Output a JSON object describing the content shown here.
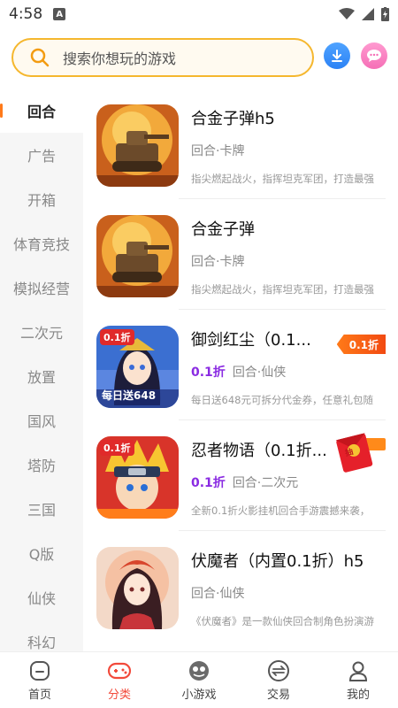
{
  "status": {
    "time": "4:58",
    "a_icon": "A"
  },
  "search": {
    "placeholder": "搜索你想玩的游戏"
  },
  "sidebar": {
    "items": [
      {
        "label": "回合",
        "active": true
      },
      {
        "label": "广告"
      },
      {
        "label": "开箱"
      },
      {
        "label": "体育竞技"
      },
      {
        "label": "模拟经营"
      },
      {
        "label": "二次元"
      },
      {
        "label": "放置"
      },
      {
        "label": "国风"
      },
      {
        "label": "塔防"
      },
      {
        "label": "三国"
      },
      {
        "label": "Q版"
      },
      {
        "label": "仙侠"
      },
      {
        "label": "科幻"
      }
    ]
  },
  "games": [
    {
      "name": "合金子弹h5",
      "tags": "回合·卡牌",
      "desc": "指尖燃起战火，指挥坦克军团，打造最强",
      "icon": "tank-art"
    },
    {
      "name": "合金子弹",
      "tags": "回合·卡牌",
      "desc": "指尖燃起战火，指挥坦克军团，打造最强",
      "icon": "tank-art"
    },
    {
      "name": "御剑红尘（0.1...",
      "discount": "0.1折",
      "tags": "回合·仙侠",
      "badge": "0.1折",
      "desc": "每日送648元可拆分代金券，任意礼包随",
      "thumb_label_top": "0.1折",
      "thumb_label_bottom": "每日送648",
      "icon": "girl-art"
    },
    {
      "name": "忍者物语（0.1折...",
      "discount": "0.1折",
      "tags": "回合·二次元",
      "desc": "全新0.1折火影挂机回合手游震撼来袭，",
      "thumb_label_top": "0.1折",
      "packet": "抽",
      "icon": "ninja-art"
    },
    {
      "name": "伏魔者（内置0.1折）h5",
      "tags": "回合·仙侠",
      "desc": "《伏魔者》是一款仙侠回合制角色扮演游",
      "icon": "fairy-art"
    }
  ],
  "nav": {
    "items": [
      {
        "label": "首页"
      },
      {
        "label": "分类",
        "active": true
      },
      {
        "label": "小游戏"
      },
      {
        "label": "交易"
      },
      {
        "label": "我的"
      }
    ]
  },
  "colors": {
    "accent": "#f24a3b",
    "search_border": "#f5b72e",
    "discount": "#8a2be2"
  }
}
